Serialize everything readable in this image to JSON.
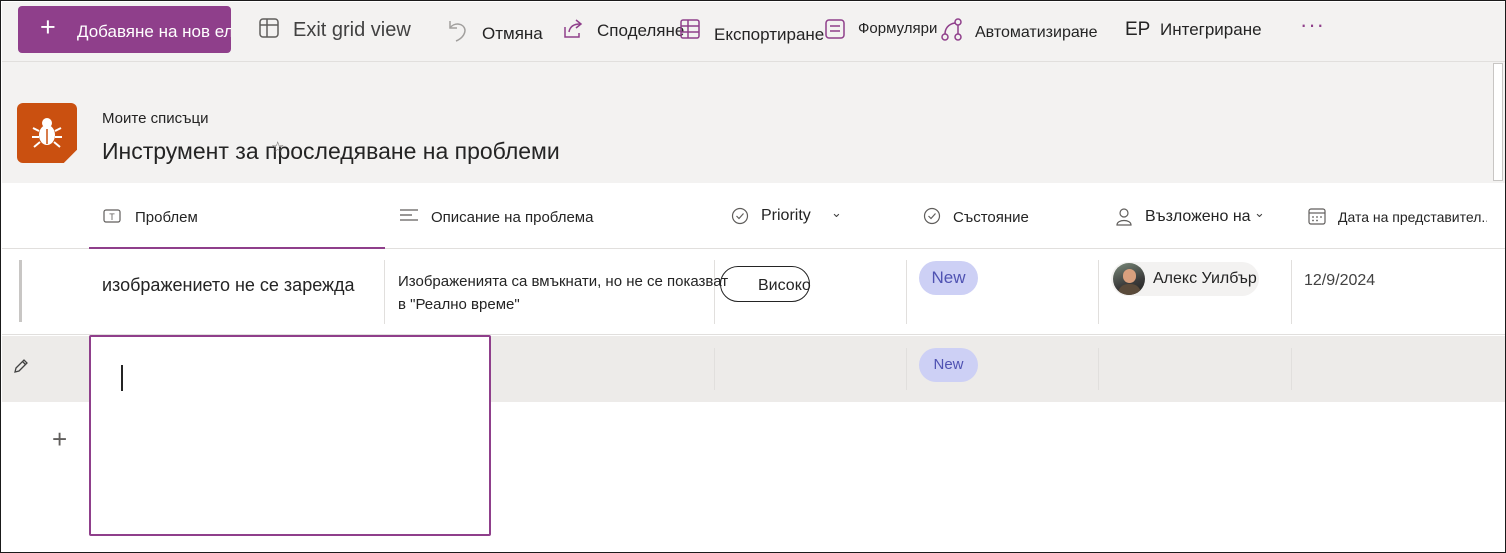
{
  "toolbar": {
    "new_item": "Добавяне на нов елемент",
    "exit_grid": "Exit grid view",
    "undo": "Отмяна",
    "share": "Споделяне",
    "export": "Експортиране",
    "forms": "Формуляри",
    "automate": "Автоматизиране",
    "integrate_initials": "EP",
    "integrate": "Интегриране",
    "more": "···"
  },
  "list": {
    "breadcrumb": "Моите списъци",
    "title": "Инструмент за проследяване на проблеми",
    "icon": "bug-icon",
    "icon_color": "#ca5010"
  },
  "columns": [
    {
      "label": "Проблем",
      "icon": "text-icon"
    },
    {
      "label": "Описание на проблема",
      "icon": "multiline-text-icon"
    },
    {
      "label": "Priority",
      "icon": "choice-check-icon"
    },
    {
      "label": "Състояние",
      "icon": "choice-check-icon"
    },
    {
      "label": "Възложено на",
      "icon": "person-icon"
    },
    {
      "label": "Дата на представител...",
      "icon": "calendar-icon"
    }
  ],
  "rows": [
    {
      "issue": "изображението не се зарежда",
      "description_line1": "Изображенията са вмъкнати, но не се показват",
      "description_line2": "в \"Реално време\"",
      "priority": "Високо",
      "status": "New",
      "assignee": "Алекс Уилбър",
      "date": "12/9/2024"
    },
    {
      "issue": "",
      "status": "New"
    }
  ],
  "colors": {
    "accent": "#8f3f8b",
    "status_pill_bg": "#cdd0f5",
    "status_pill_text": "#4f52b2"
  }
}
